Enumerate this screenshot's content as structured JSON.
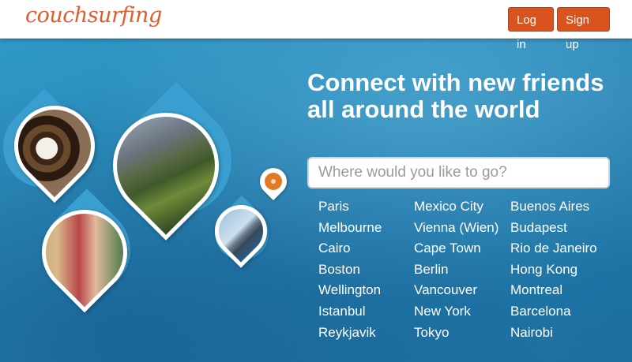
{
  "header": {
    "logo": "couchsurfing",
    "login_label": "Log in",
    "signup_label": "Sign up"
  },
  "hero": {
    "headline": "Connect with new friends all around the world",
    "search_placeholder": "Where would you like to go?",
    "cities": [
      [
        "Paris",
        "Melbourne",
        "Cairo",
        "Boston",
        "Wellington",
        "Istanbul",
        "Reykjavik"
      ],
      [
        "Mexico City",
        "Vienna (Wien)",
        "Cape Town",
        "Berlin",
        "Vancouver",
        "New York",
        "Tokyo"
      ],
      [
        "Buenos Aires",
        "Budapest",
        "Rio de Janeiro",
        "Hong Kong",
        "Montreal",
        "Barcelona",
        "Nairobi"
      ]
    ]
  },
  "icons": {
    "pin": "map-pin-icon"
  },
  "colors": {
    "brand_orange": "#d9531e",
    "hero_blue": "#2b8dbb"
  }
}
